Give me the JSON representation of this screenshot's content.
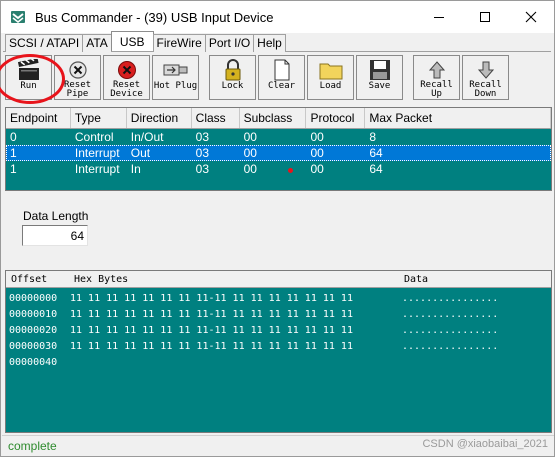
{
  "window": {
    "title": "Bus Commander - (39) USB Input Device",
    "icon": "bus-commander-app-icon",
    "controls": [
      "minimize-icon",
      "maximize-icon",
      "close-icon"
    ]
  },
  "tabs": [
    {
      "label": "SCSI / ATAPI",
      "active": false
    },
    {
      "label": "ATA",
      "active": false
    },
    {
      "label": "USB",
      "active": true
    },
    {
      "label": "FireWire",
      "active": false
    },
    {
      "label": "Port I/O",
      "active": false
    },
    {
      "label": "Help",
      "active": false
    }
  ],
  "toolbar": {
    "run": {
      "label": "Run",
      "icon": "clapperboard-icon"
    },
    "reset_pipe": {
      "label": "Reset\nPipe",
      "icon": "x-circle-icon"
    },
    "reset_device": {
      "label": "Reset\nDevice",
      "icon": "red-x-icon"
    },
    "hot_plug": {
      "label": "Hot Plug",
      "icon": "usb-plug-icon"
    },
    "lock": {
      "label": "Lock",
      "icon": "padlock-icon"
    },
    "clear": {
      "label": "Clear",
      "icon": "blank-page-icon"
    },
    "load": {
      "label": "Load",
      "icon": "folder-icon"
    },
    "save": {
      "label": "Save",
      "icon": "floppy-disk-icon"
    },
    "recall_up": {
      "label": "Recall\nUp",
      "icon": "arrow-up-icon"
    },
    "recall_down": {
      "label": "Recall\nDown",
      "icon": "arrow-down-icon"
    }
  },
  "endpoints": {
    "columns": [
      "Endpoint",
      "Type",
      "Direction",
      "Class",
      "Subclass",
      "Protocol",
      "Max Packet"
    ],
    "rows": [
      {
        "endpoint": "0",
        "type": "Control",
        "direction": "In/Out",
        "class": "03",
        "subclass": "00",
        "protocol": "00",
        "max_packet": "8",
        "selected": false
      },
      {
        "endpoint": "1",
        "type": "Interrupt",
        "direction": "Out",
        "class": "03",
        "subclass": "00",
        "protocol": "00",
        "max_packet": "64",
        "selected": true
      },
      {
        "endpoint": "1",
        "type": "Interrupt",
        "direction": "In",
        "class": "03",
        "subclass": "00",
        "protocol": "00",
        "max_packet": "64",
        "selected": false
      }
    ]
  },
  "data_length": {
    "label": "Data Length",
    "value": "64"
  },
  "hex_view": {
    "headers": {
      "offset": "Offset",
      "hex": "Hex Bytes",
      "data": "Data"
    },
    "rows": [
      {
        "offset": "00000000",
        "bytes": "11 11 11 11 11 11 11 11-11 11 11 11 11 11 11 11",
        "ascii": "................"
      },
      {
        "offset": "00000010",
        "bytes": "11 11 11 11 11 11 11 11-11 11 11 11 11 11 11 11",
        "ascii": "................"
      },
      {
        "offset": "00000020",
        "bytes": "11 11 11 11 11 11 11 11-11 11 11 11 11 11 11 11",
        "ascii": "................"
      },
      {
        "offset": "00000030",
        "bytes": "11 11 11 11 11 11 11 11-11 11 11 11 11 11 11 11",
        "ascii": "................"
      },
      {
        "offset": "00000040",
        "bytes": "",
        "ascii": ""
      }
    ]
  },
  "status": {
    "text": "complete",
    "color": "#2e8b2e"
  },
  "watermark": "CSDN @xiaobaibai_2021",
  "colors": {
    "grid_bg": "#008080",
    "selection": "#0078d7",
    "annotation": "#e8141b"
  }
}
